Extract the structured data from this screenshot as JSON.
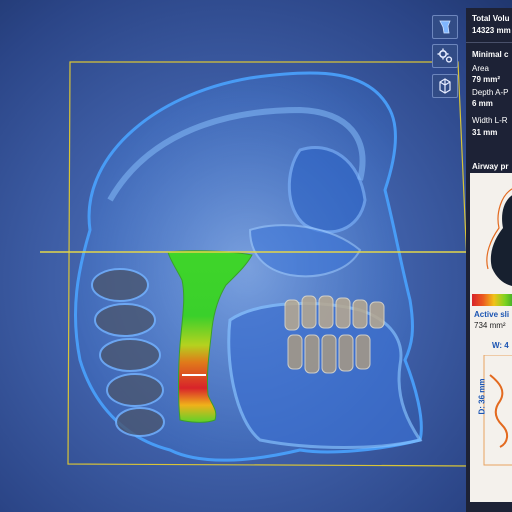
{
  "stats": {
    "total_volume_label": "Total Volu",
    "total_volume_value": "14323 mm",
    "minimal_label": "Minimal c",
    "area_label": "Area",
    "area_value": "79 mm²",
    "depth_label": "Depth A-P",
    "depth_value": "6 mm",
    "width_label": "Width L-R",
    "width_value": "31 mm"
  },
  "airway_panel": {
    "title": "Airway pr",
    "active_slice_label": "Active sli",
    "active_slice_value": "734 mm²",
    "width_label": "W: 4",
    "depth_label": "D: 36 mm"
  },
  "toolbar": {
    "icons": [
      "airway-model-icon",
      "settings-icon",
      "view-cube-icon"
    ]
  },
  "colors": {
    "bone": "#3a8cff",
    "crop_box": "#d8c437",
    "slice_line": "#e2d64a",
    "airway_wide": "#2ca02c",
    "airway_narrow": "#d8232a",
    "panel_bg": "#1d2236",
    "accent_text": "#1b55b3"
  }
}
